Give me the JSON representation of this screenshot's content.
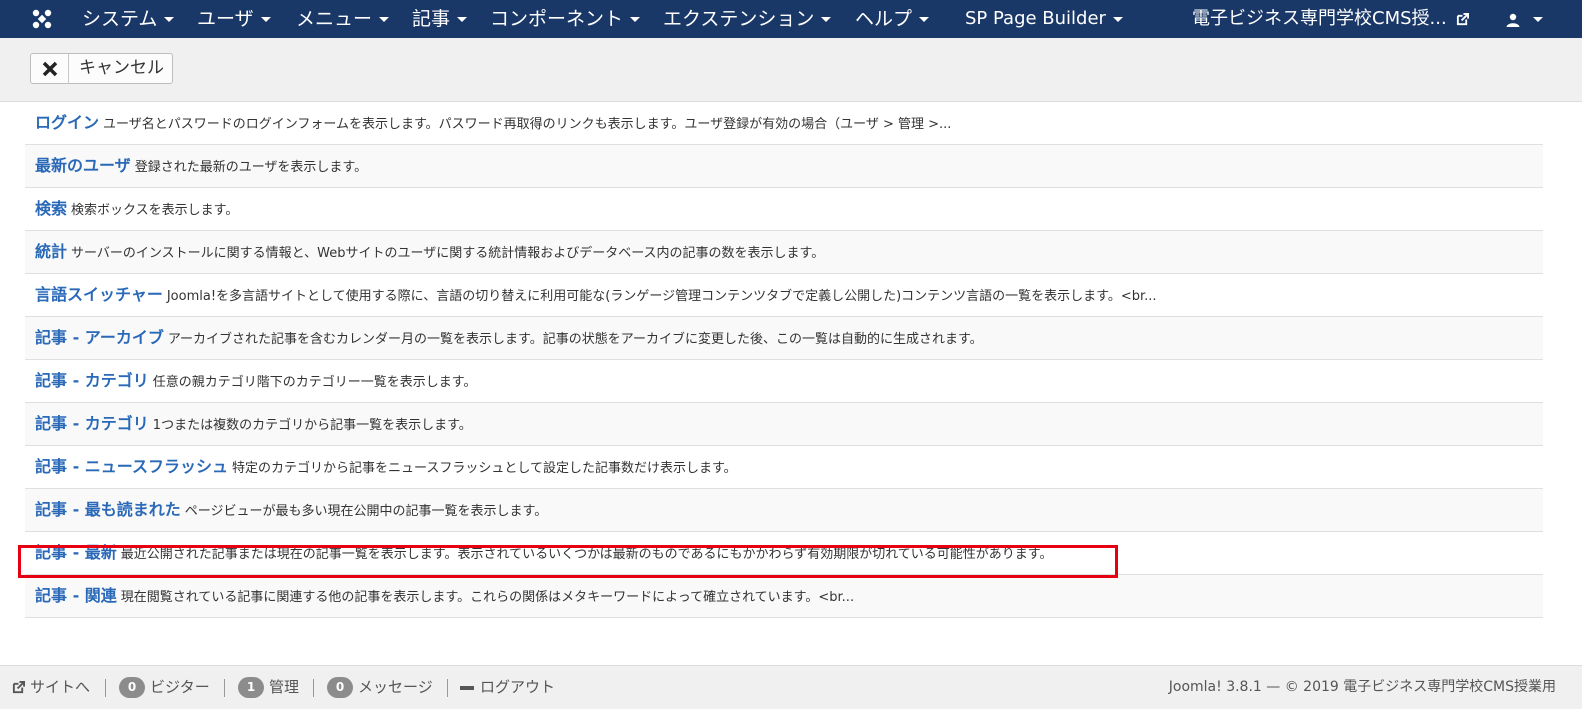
{
  "nav": {
    "items": [
      {
        "label": "システム",
        "dropdown": true
      },
      {
        "label": "ユーザ",
        "dropdown": true
      },
      {
        "label": "メニュー",
        "dropdown": true
      },
      {
        "label": "記事",
        "dropdown": true
      },
      {
        "label": "コンポーネント",
        "dropdown": true
      },
      {
        "label": "エクステンション",
        "dropdown": true
      },
      {
        "label": "ヘルプ",
        "dropdown": true
      },
      {
        "label": "SP Page Builder",
        "dropdown": true
      }
    ],
    "site_title": "電子ビジネス専門学校CMS授...",
    "icons": {
      "logo": "joomla-logo-icon",
      "external": "external-link-icon",
      "user": "user-icon"
    }
  },
  "toolbar": {
    "cancel_label": "キャンセル"
  },
  "modules": [
    {
      "title": "ログイン",
      "desc": "ユーザ名とパスワードのログインフォームを表示します。パスワード再取得のリンクも表示します。ユーザ登録が有効の場合（ユーザ > 管理 >..."
    },
    {
      "title": "最新のユーザ",
      "desc": "登録された最新のユーザを表示します。"
    },
    {
      "title": "検索",
      "desc": "検索ボックスを表示します。"
    },
    {
      "title": "統計",
      "desc": "サーバーのインストールに関する情報と、Webサイトのユーザに関する統計情報およびデータベース内の記事の数を表示します。"
    },
    {
      "title": "言語スイッチャー",
      "desc": "Joomla!を多言語サイトとして使用する際に、言語の切り替えに利用可能な(ランゲージ管理コンテンツタブで定義し公開した)コンテンツ言語の一覧を表示します。<br..."
    },
    {
      "title": "記事 - アーカイブ",
      "desc": "アーカイブされた記事を含むカレンダー月の一覧を表示します。記事の状態をアーカイブに変更した後、この一覧は自動的に生成されます。"
    },
    {
      "title": "記事 - カテゴリ",
      "desc": "任意の親カテゴリ階下のカテゴリー一覧を表示します。"
    },
    {
      "title": "記事 - カテゴリ",
      "desc": "1つまたは複数のカテゴリから記事一覧を表示します。"
    },
    {
      "title": "記事 - ニュースフラッシュ",
      "desc": "特定のカテゴリから記事をニュースフラッシュとして設定した記事数だけ表示します。"
    },
    {
      "title": "記事 - 最も読まれた",
      "desc": "ページビューが最も多い現在公開中の記事一覧を表示します。"
    },
    {
      "title": "記事 - 最新",
      "desc": "最近公開された記事または現在の記事一覧を表示します。表示されているいくつかは最新のものであるにもかかわらず有効期限が切れている可能性があります。"
    },
    {
      "title": "記事 - 関連",
      "desc": "現在閲覧されている記事に関連する他の記事を表示します。これらの関係はメタキーワードによって確立されています。<br..."
    }
  ],
  "footer": {
    "site": "サイトへ",
    "visitors": {
      "count": "0",
      "label": "ビジター"
    },
    "admins": {
      "count": "1",
      "label": "管理"
    },
    "messages": {
      "count": "0",
      "label": "メッセージ"
    },
    "logout": "ログアウト",
    "copyright": "Joomla! 3.8.1 — © 2019 電子ビジネス専門学校CMS授業用"
  },
  "colors": {
    "navbar": "#1a3867",
    "link": "#2a69b8",
    "highlight": "#e60012"
  }
}
